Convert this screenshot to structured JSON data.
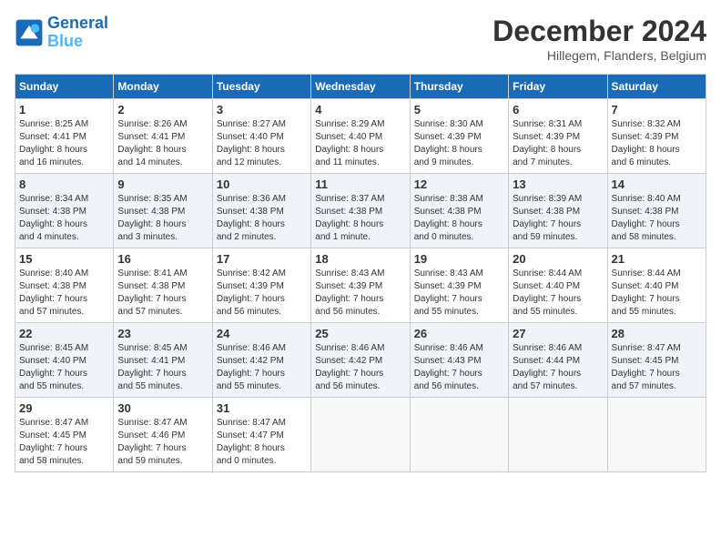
{
  "header": {
    "logo_line1": "General",
    "logo_line2": "Blue",
    "month": "December 2024",
    "location": "Hillegem, Flanders, Belgium"
  },
  "days_of_week": [
    "Sunday",
    "Monday",
    "Tuesday",
    "Wednesday",
    "Thursday",
    "Friday",
    "Saturday"
  ],
  "weeks": [
    [
      {
        "day": "1",
        "info": "Sunrise: 8:25 AM\nSunset: 4:41 PM\nDaylight: 8 hours\nand 16 minutes."
      },
      {
        "day": "2",
        "info": "Sunrise: 8:26 AM\nSunset: 4:41 PM\nDaylight: 8 hours\nand 14 minutes."
      },
      {
        "day": "3",
        "info": "Sunrise: 8:27 AM\nSunset: 4:40 PM\nDaylight: 8 hours\nand 12 minutes."
      },
      {
        "day": "4",
        "info": "Sunrise: 8:29 AM\nSunset: 4:40 PM\nDaylight: 8 hours\nand 11 minutes."
      },
      {
        "day": "5",
        "info": "Sunrise: 8:30 AM\nSunset: 4:39 PM\nDaylight: 8 hours\nand 9 minutes."
      },
      {
        "day": "6",
        "info": "Sunrise: 8:31 AM\nSunset: 4:39 PM\nDaylight: 8 hours\nand 7 minutes."
      },
      {
        "day": "7",
        "info": "Sunrise: 8:32 AM\nSunset: 4:39 PM\nDaylight: 8 hours\nand 6 minutes."
      }
    ],
    [
      {
        "day": "8",
        "info": "Sunrise: 8:34 AM\nSunset: 4:38 PM\nDaylight: 8 hours\nand 4 minutes."
      },
      {
        "day": "9",
        "info": "Sunrise: 8:35 AM\nSunset: 4:38 PM\nDaylight: 8 hours\nand 3 minutes."
      },
      {
        "day": "10",
        "info": "Sunrise: 8:36 AM\nSunset: 4:38 PM\nDaylight: 8 hours\nand 2 minutes."
      },
      {
        "day": "11",
        "info": "Sunrise: 8:37 AM\nSunset: 4:38 PM\nDaylight: 8 hours\nand 1 minute."
      },
      {
        "day": "12",
        "info": "Sunrise: 8:38 AM\nSunset: 4:38 PM\nDaylight: 8 hours\nand 0 minutes."
      },
      {
        "day": "13",
        "info": "Sunrise: 8:39 AM\nSunset: 4:38 PM\nDaylight: 7 hours\nand 59 minutes."
      },
      {
        "day": "14",
        "info": "Sunrise: 8:40 AM\nSunset: 4:38 PM\nDaylight: 7 hours\nand 58 minutes."
      }
    ],
    [
      {
        "day": "15",
        "info": "Sunrise: 8:40 AM\nSunset: 4:38 PM\nDaylight: 7 hours\nand 57 minutes."
      },
      {
        "day": "16",
        "info": "Sunrise: 8:41 AM\nSunset: 4:38 PM\nDaylight: 7 hours\nand 57 minutes."
      },
      {
        "day": "17",
        "info": "Sunrise: 8:42 AM\nSunset: 4:39 PM\nDaylight: 7 hours\nand 56 minutes."
      },
      {
        "day": "18",
        "info": "Sunrise: 8:43 AM\nSunset: 4:39 PM\nDaylight: 7 hours\nand 56 minutes."
      },
      {
        "day": "19",
        "info": "Sunrise: 8:43 AM\nSunset: 4:39 PM\nDaylight: 7 hours\nand 55 minutes."
      },
      {
        "day": "20",
        "info": "Sunrise: 8:44 AM\nSunset: 4:40 PM\nDaylight: 7 hours\nand 55 minutes."
      },
      {
        "day": "21",
        "info": "Sunrise: 8:44 AM\nSunset: 4:40 PM\nDaylight: 7 hours\nand 55 minutes."
      }
    ],
    [
      {
        "day": "22",
        "info": "Sunrise: 8:45 AM\nSunset: 4:40 PM\nDaylight: 7 hours\nand 55 minutes."
      },
      {
        "day": "23",
        "info": "Sunrise: 8:45 AM\nSunset: 4:41 PM\nDaylight: 7 hours\nand 55 minutes."
      },
      {
        "day": "24",
        "info": "Sunrise: 8:46 AM\nSunset: 4:42 PM\nDaylight: 7 hours\nand 55 minutes."
      },
      {
        "day": "25",
        "info": "Sunrise: 8:46 AM\nSunset: 4:42 PM\nDaylight: 7 hours\nand 56 minutes."
      },
      {
        "day": "26",
        "info": "Sunrise: 8:46 AM\nSunset: 4:43 PM\nDaylight: 7 hours\nand 56 minutes."
      },
      {
        "day": "27",
        "info": "Sunrise: 8:46 AM\nSunset: 4:44 PM\nDaylight: 7 hours\nand 57 minutes."
      },
      {
        "day": "28",
        "info": "Sunrise: 8:47 AM\nSunset: 4:45 PM\nDaylight: 7 hours\nand 57 minutes."
      }
    ],
    [
      {
        "day": "29",
        "info": "Sunrise: 8:47 AM\nSunset: 4:45 PM\nDaylight: 7 hours\nand 58 minutes."
      },
      {
        "day": "30",
        "info": "Sunrise: 8:47 AM\nSunset: 4:46 PM\nDaylight: 7 hours\nand 59 minutes."
      },
      {
        "day": "31",
        "info": "Sunrise: 8:47 AM\nSunset: 4:47 PM\nDaylight: 8 hours\nand 0 minutes."
      },
      {
        "day": "",
        "info": ""
      },
      {
        "day": "",
        "info": ""
      },
      {
        "day": "",
        "info": ""
      },
      {
        "day": "",
        "info": ""
      }
    ]
  ]
}
